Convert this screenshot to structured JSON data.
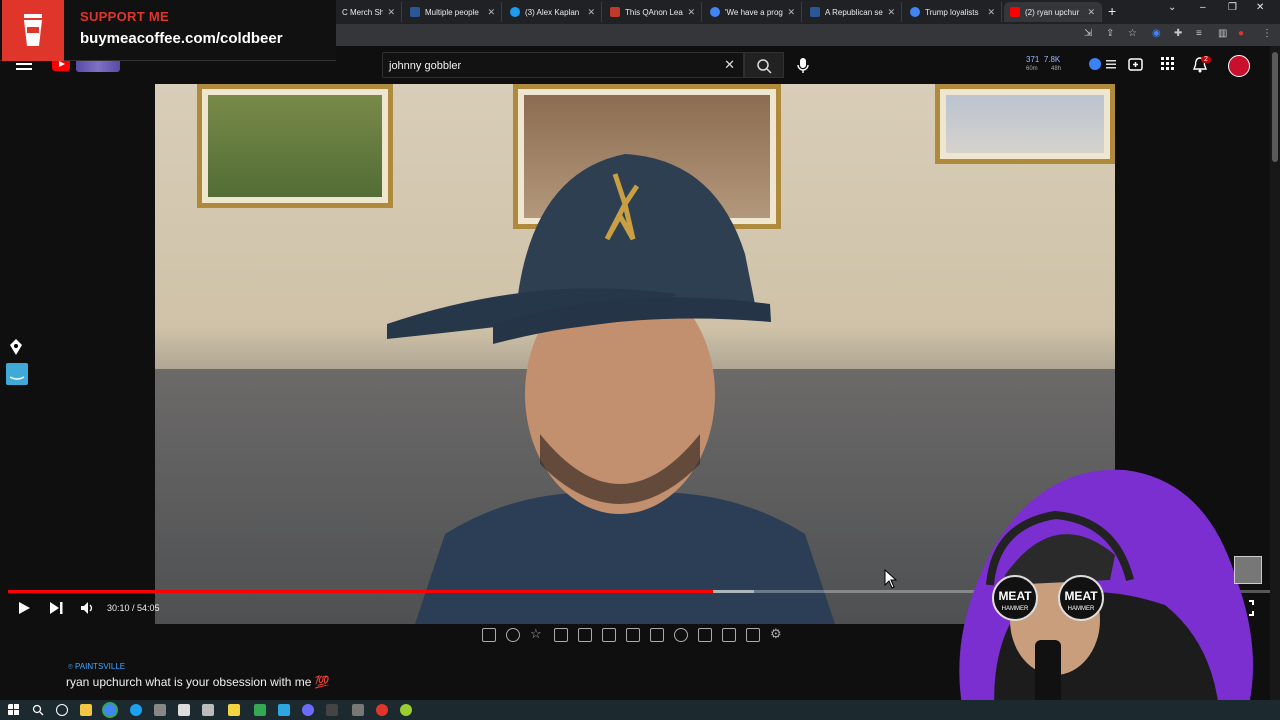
{
  "overlay": {
    "support_title": "SUPPORT ME",
    "support_url": "buymeacoffee.com/coldbeer"
  },
  "tabs": [
    {
      "label": "C Merch Shop",
      "color": "#2b5797"
    },
    {
      "label": "Multiple people",
      "color": "#2b5797"
    },
    {
      "label": "(3) Alex Kaplan",
      "color": "#1d9bf0"
    },
    {
      "label": "This QAnon Lea",
      "color": "#c0392b"
    },
    {
      "label": "'We have a prog",
      "color": "#4285f4"
    },
    {
      "label": "A Republican se",
      "color": "#2b5797"
    },
    {
      "label": "Trump loyalists",
      "color": "#4285f4"
    },
    {
      "label": "(2) ryan upchur",
      "color": "#ff0000"
    }
  ],
  "search": {
    "query": "johnny gobbler"
  },
  "header": {
    "stat_a": "371",
    "stat_a_sub": "60m",
    "stat_b": "7.8K",
    "stat_b_sub": "48h",
    "notifications": "2"
  },
  "player": {
    "time": "30:10 / 54:05",
    "played_fraction": 0.558,
    "loaded_fraction": 0.59
  },
  "chat": {
    "location": "PAINTSVILLE",
    "message": "ryan upchurch what is your obsession with me 💯"
  },
  "webcam": {
    "hat_left": "MEAT",
    "hat_left_sub": "HAMMER",
    "hat_right": "MEAT",
    "hat_right_sub": "HAMMER"
  },
  "colors": {
    "progress": "#ff0000",
    "accent": "#7b2fd0"
  }
}
